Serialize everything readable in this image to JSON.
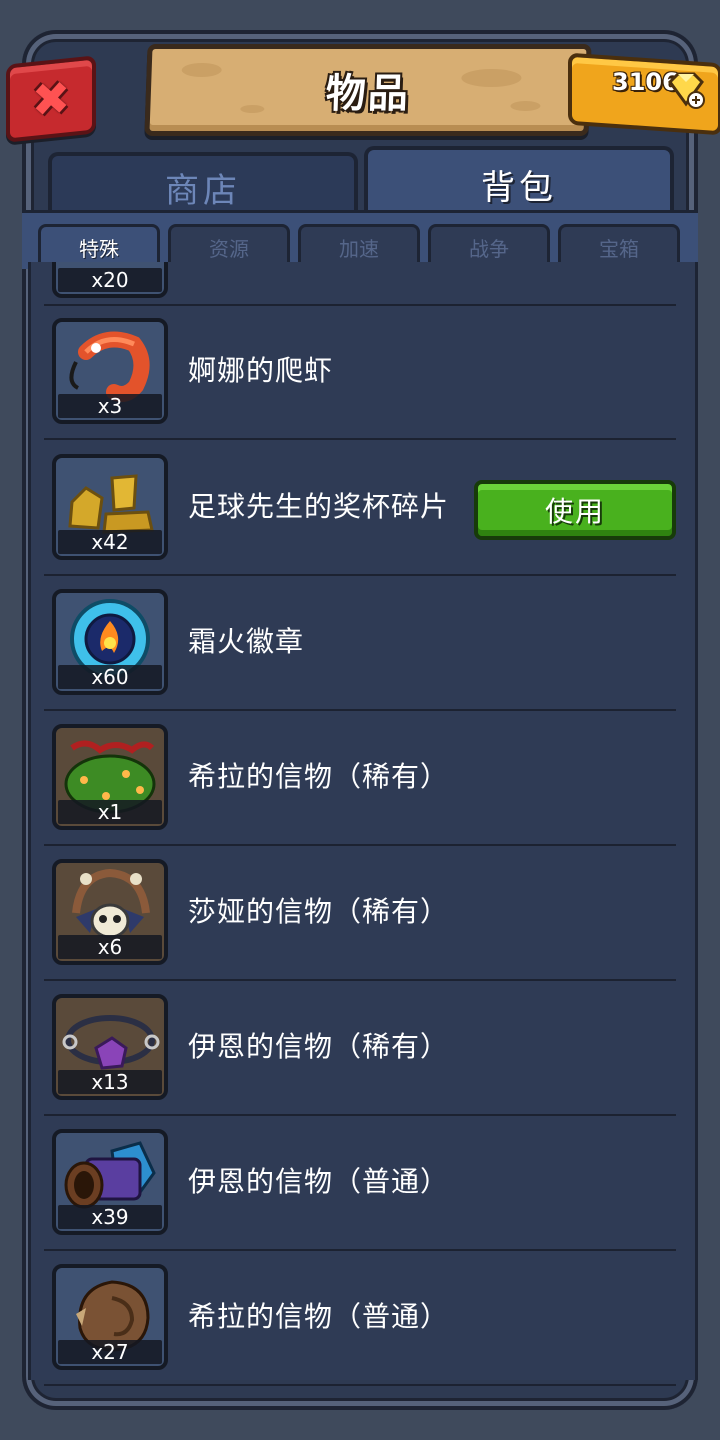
{
  "header": {
    "title": "物品",
    "gems": "3106",
    "close_icon": "close-icon"
  },
  "tabs": {
    "shop": "商店",
    "bag": "背包",
    "active": "bag"
  },
  "subtabs": [
    "特殊",
    "资源",
    "加速",
    "战争",
    "宝箱"
  ],
  "active_subtab": 0,
  "items": [
    {
      "qty": "x20",
      "name": "",
      "icon": "item-icon"
    },
    {
      "qty": "x3",
      "name": "婀娜的爬虾",
      "icon": "shrimp-icon"
    },
    {
      "qty": "x42",
      "name": "足球先生的奖杯碎片",
      "icon": "trophy-fragment-icon",
      "button": "使用"
    },
    {
      "qty": "x60",
      "name": "霜火徽章",
      "icon": "frostfire-badge-icon"
    },
    {
      "qty": "x1",
      "name": "希拉的信物（稀有）",
      "icon": "flower-bush-icon"
    },
    {
      "qty": "x6",
      "name": "莎娅的信物（稀有）",
      "icon": "skull-bone-icon"
    },
    {
      "qty": "x13",
      "name": "伊恩的信物（稀有）",
      "icon": "purple-gem-chain-icon"
    },
    {
      "qty": "x39",
      "name": "伊恩的信物（普通）",
      "icon": "cannon-icon"
    },
    {
      "qty": "x27",
      "name": "希拉的信物（普通）",
      "icon": "wood-log-icon"
    }
  ],
  "colors": {
    "panel": "#2f3b55",
    "accent_gold": "#f0a51c",
    "use_button": "#49b11e",
    "close_button": "#c62a2e"
  }
}
